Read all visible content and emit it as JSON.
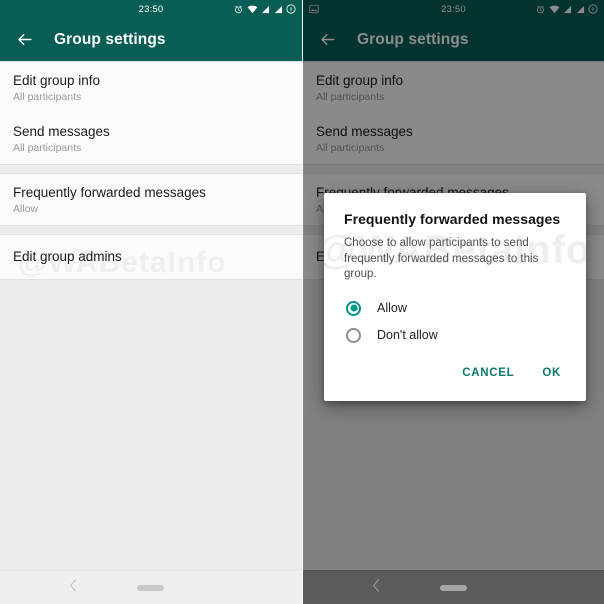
{
  "theme": {
    "toolbar_color": "#075e54",
    "accent_color": "#009688",
    "action_text_color": "#0c7a6b",
    "list_bg": "#fbfbfb",
    "page_bg": "#ececec"
  },
  "watermark": "@WABetaInfo",
  "status_bar": {
    "clock": "23:50",
    "icons_right": [
      "alarm-icon",
      "wifi-icon",
      "signal-icon-1",
      "signal-icon-2",
      "battery-icon"
    ],
    "icons_left_left_panel": [],
    "icons_left_right_panel": [
      "screenshot-icon"
    ]
  },
  "toolbar": {
    "back_label": "Back",
    "title": "Group settings"
  },
  "settings_list": [
    {
      "section": 1,
      "items": [
        {
          "primary": "Edit group info",
          "secondary": "All participants"
        },
        {
          "primary": "Send messages",
          "secondary": "All participants"
        }
      ]
    },
    {
      "section": 2,
      "items": [
        {
          "primary": "Frequently forwarded messages",
          "secondary": "Allow"
        }
      ]
    },
    {
      "section": 3,
      "items": [
        {
          "primary": "Edit group admins",
          "secondary": ""
        }
      ]
    }
  ],
  "dialog": {
    "title": "Frequently forwarded messages",
    "body": "Choose to allow participants to send frequently forwarded messages to this group.",
    "options": [
      {
        "label": "Allow",
        "selected": true
      },
      {
        "label": "Don't allow",
        "selected": false
      }
    ],
    "cancel_label": "CANCEL",
    "ok_label": "OK"
  },
  "nav_bar": {
    "back_icon": "nav-back-icon",
    "home_pill": "home-indicator"
  }
}
